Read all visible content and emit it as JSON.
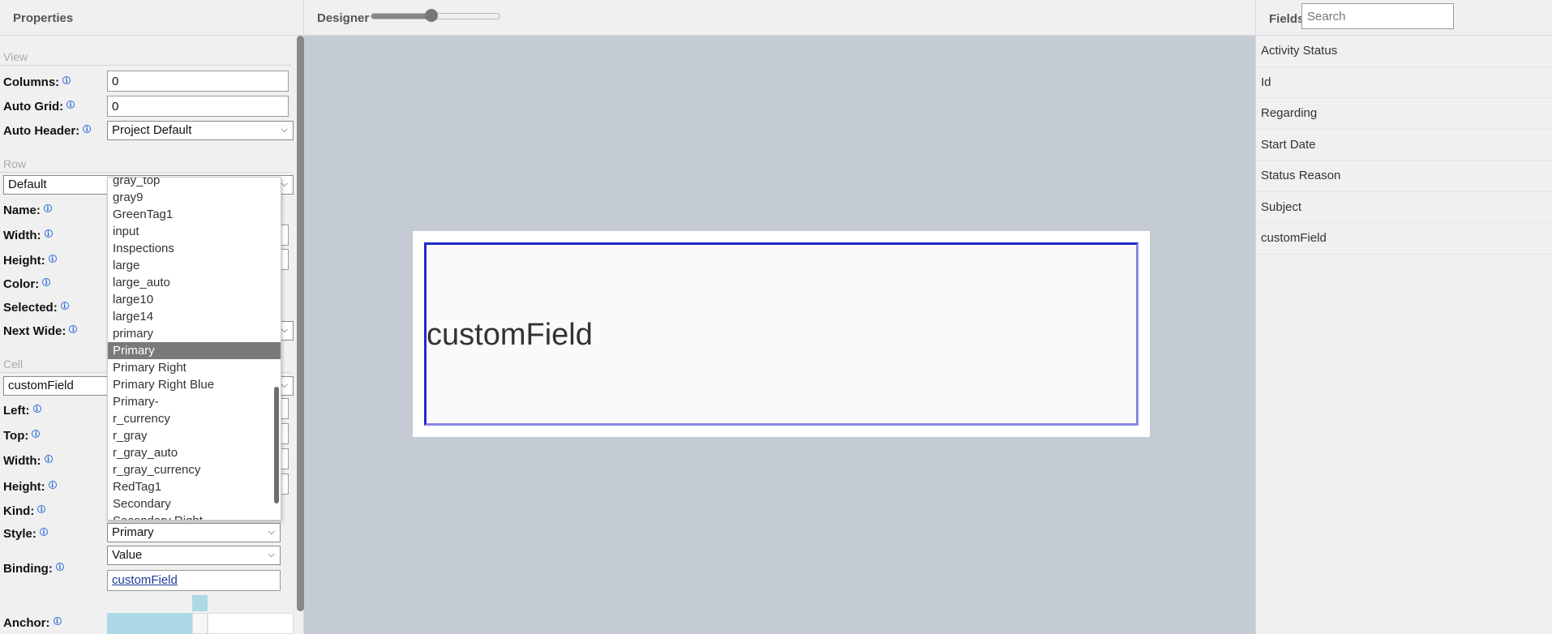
{
  "left": {
    "title": "Properties",
    "view_section": "View",
    "columns_label": "Columns:",
    "columns_value": "0",
    "autogrid_label": "Auto Grid:",
    "autogrid_value": "0",
    "autoheader_label": "Auto Header:",
    "autoheader_value": "Project Default",
    "row_section": "Row",
    "row_select": "Default",
    "name_label": "Name:",
    "width_label": "Width:",
    "height_label": "Height:",
    "color_label": "Color:",
    "selected_label": "Selected:",
    "nextwide_label": "Next Wide:",
    "cell_section": "Cell",
    "cell_select": "customField",
    "left_label": "Left:",
    "top_label": "Top:",
    "cell_width_label": "Width:",
    "cell_height_label": "Height:",
    "kind_label": "Kind:",
    "style_label": "Style:",
    "style_value": "Primary",
    "binding_label": "Binding:",
    "binding_value": "Value",
    "binding_link": "customField",
    "anchor_label": "Anchor:",
    "info_glyph": "i"
  },
  "dropdown": {
    "options": [
      "gray_top",
      "gray9",
      "GreenTag1",
      "input",
      "Inspections",
      "large",
      "large_auto",
      "large10",
      "large14",
      "primary",
      "Primary",
      "Primary Right",
      "Primary Right Blue",
      "Primary-",
      "r_currency",
      "r_gray",
      "r_gray_auto",
      "r_gray_currency",
      "RedTag1",
      "Secondary",
      "Secondary Right"
    ],
    "selected": "Primary"
  },
  "center": {
    "title": "Designer",
    "zoom_level": 0.5,
    "field_text": "customField"
  },
  "right": {
    "title": "Fields",
    "search_placeholder": "Search",
    "fields": [
      "Activity Status",
      "Id",
      "Regarding",
      "Start Date",
      "Status Reason",
      "Subject",
      "customField"
    ]
  },
  "colors": {
    "selection_border": "#1f2ccc",
    "anchor_fill": "#add8e6",
    "link": "#1a3c9c"
  }
}
